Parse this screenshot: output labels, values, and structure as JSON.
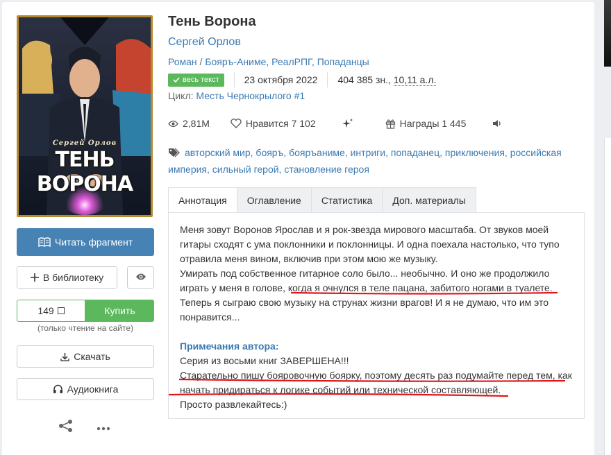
{
  "cover": {
    "author": "Сергей Орлов",
    "title": "ТЕНЬ ВОРОНА",
    "border_color": "#b88a2f"
  },
  "book": {
    "title": "Тень Ворона",
    "author": "Сергей Орлов",
    "form": "Роман",
    "genres": [
      "Бояръ-Аниме",
      "РеалРПГ",
      "Попаданцы"
    ],
    "badge": "весь текст",
    "date": "23 октября 2022",
    "size": "404 385 зн.,",
    "sheets": "10,11 а.л.",
    "cycle_label": "Цикл:",
    "cycle_name": "Месть Чернокрылого #1"
  },
  "stats": {
    "views": "2,81M",
    "likes": "Нравится 7 102",
    "awards": "Награды 1 445"
  },
  "tags": [
    "авторский мир",
    "бояръ",
    "бояръаниме",
    "интриги",
    "попаданец",
    "приключения",
    "российская империя",
    "сильный герой",
    "становление героя"
  ],
  "tabs": [
    "Аннотация",
    "Оглавление",
    "Статистика",
    "Доп. материалы"
  ],
  "annotation": {
    "line1": "Меня зовут Воронов Ярослав и я рок-звезда мирового масштаба. От звуков моей",
    "line2": "гитары сходят с ума поклонники и поклонницы. И одна поехала настолько, что тупо",
    "line3": "отравила меня вином, включив при этом мою же музыку.",
    "line4": "Умирать под собственное гитарное соло было... необычно. И оно же продолжило",
    "line5": "играть у меня в голове, когда я очнулся в теле пацана, забитого ногами в туалете.",
    "line6": "Теперь я сыграю свою музыку на струнах жизни врагов! И я не думаю, что им это",
    "line7": "понравится...",
    "notes_title": "Примечания автора:",
    "note1": "Серия из восьми книг ЗАВЕРШЕНА!!!",
    "note2": "Старательно пишу бояровочную боярку, поэтому десять раз подумайте перед тем, как",
    "note3": "начать придираться к логике событий или технической составляющей.",
    "note4": "Просто развлекайтесь:)"
  },
  "buttons": {
    "read": "Читать фрагмент",
    "library": "В библиотеку",
    "price": "149",
    "buy": "Купить",
    "only_read": "(только чтение на сайте)",
    "download": "Скачать",
    "audio": "Аудиокнига"
  },
  "colors": {
    "accent": "#4682b4",
    "buy": "#5cb85c",
    "link": "#3a7ab3",
    "underline": "#e0161b"
  }
}
